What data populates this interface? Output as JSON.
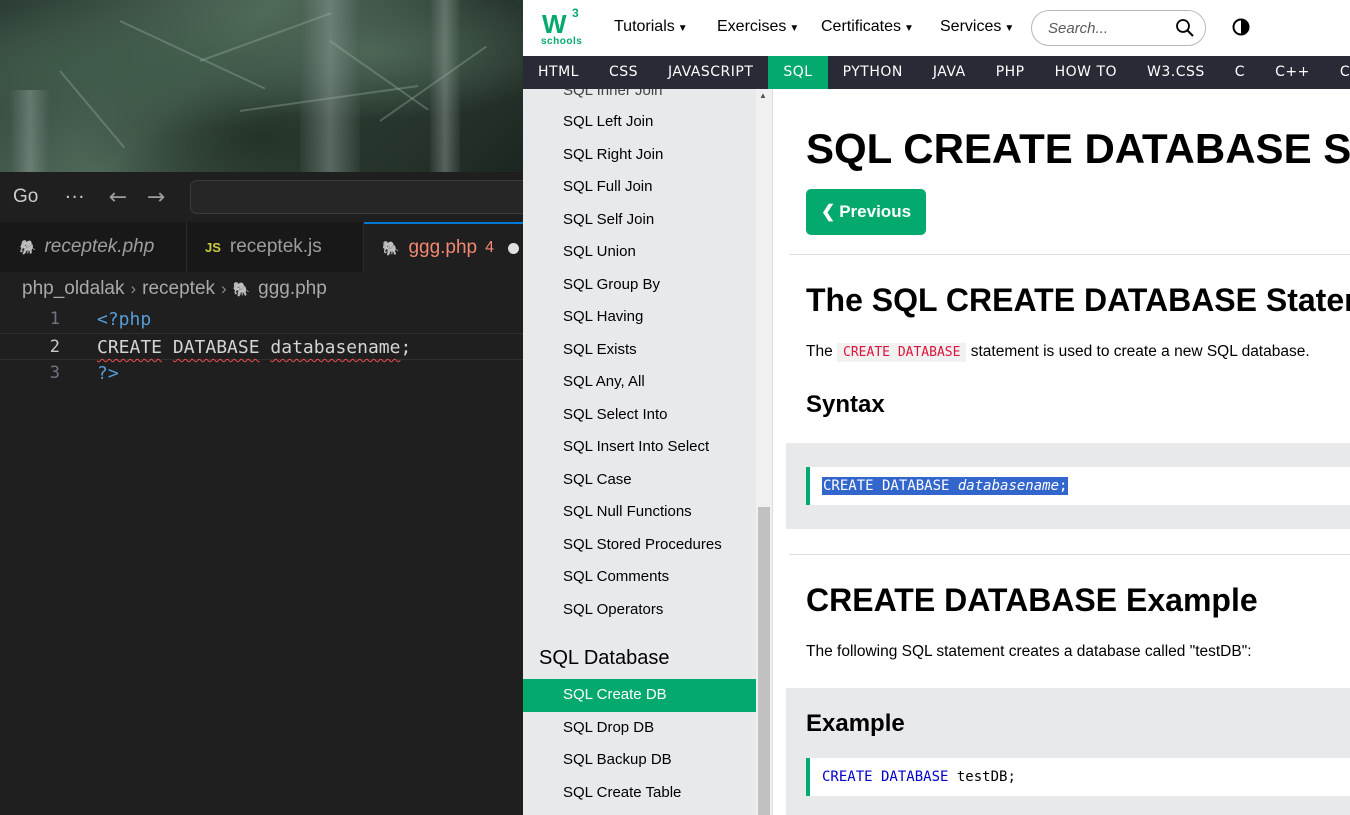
{
  "editor": {
    "menu": {
      "go": "Go",
      "more": "···"
    },
    "nav": {
      "back": "←",
      "forward": "→"
    },
    "tabs": [
      {
        "label": "receptek.php",
        "icon": "php-elephant-icon",
        "italic": true
      },
      {
        "label": "receptek.js",
        "icon": "js-icon",
        "icon_text": "JS"
      },
      {
        "label": "ggg.php",
        "icon": "php-elephant-icon",
        "problems": "4",
        "modified": true
      }
    ],
    "breadcrumb": [
      "php_oldalak",
      "receptek",
      "ggg.php"
    ],
    "code_lines": [
      {
        "number": "1",
        "text": "<?php"
      },
      {
        "number": "2",
        "text": "CREATE DATABASE databasename;"
      },
      {
        "number": "3",
        "text": "?>"
      }
    ],
    "colors": {
      "error": "#f14c4c",
      "accent": "#0078d4"
    }
  },
  "browser": {
    "logo": {
      "w": "W",
      "superscript": "3",
      "sub": "schools"
    },
    "topnav": [
      "Tutorials",
      "Exercises",
      "Certificates",
      "Services"
    ],
    "search": {
      "placeholder": "Search..."
    },
    "langbar": [
      "HTML",
      "CSS",
      "JAVASCRIPT",
      "SQL",
      "PYTHON",
      "JAVA",
      "PHP",
      "HOW TO",
      "W3.CSS",
      "C",
      "C++",
      "C#"
    ],
    "langbar_active": "SQL",
    "sidebar": {
      "items_top": [
        "SQL Inner Join",
        "SQL Left Join",
        "SQL Right Join",
        "SQL Full Join",
        "SQL Self Join",
        "SQL Union",
        "SQL Group By",
        "SQL Having",
        "SQL Exists",
        "SQL Any, All",
        "SQL Select Into",
        "SQL Insert Into Select",
        "SQL Case",
        "SQL Null Functions",
        "SQL Stored Procedures",
        "SQL Comments",
        "SQL Operators"
      ],
      "section_heading": "SQL Database",
      "items_db": [
        "SQL Create DB",
        "SQL Drop DB",
        "SQL Backup DB",
        "SQL Create Table"
      ],
      "active_item": "SQL Create DB"
    },
    "content": {
      "title": "SQL CREATE DATABASE Statement",
      "prev_button": "Previous",
      "section1_heading": "The SQL CREATE DATABASE Statement",
      "section1_text_before": "The",
      "section1_code": "CREATE DATABASE",
      "section1_text_after": "statement is used to create a new SQL database.",
      "syntax_heading": "Syntax",
      "syntax_code_kw": "CREATE DATABASE",
      "syntax_code_arg": "databasename",
      "syntax_code_end": ";",
      "section2_heading": "CREATE DATABASE Example",
      "section2_text": "The following SQL statement creates a database called \"testDB\":",
      "example_heading": "Example",
      "example_code_kw": "CREATE DATABASE",
      "example_code_rest": "testDB;"
    },
    "colors": {
      "brand_green": "#04aa6d",
      "langbar_bg": "#282a35",
      "sidebar_bg": "#e7e9eb",
      "inline_code": "#dc143c",
      "selection": "#3366cc"
    }
  }
}
